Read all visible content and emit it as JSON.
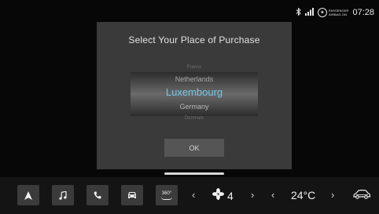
{
  "statusbar": {
    "airbag_line1": "PASSENGER",
    "airbag_line2": "AIRBAG ON",
    "time": "07:28"
  },
  "dialog": {
    "title": "Select Your Place of Purchase",
    "picker": {
      "items": [
        "France",
        "Netherlands",
        "Luxembourg",
        "Germany",
        "Denmark"
      ],
      "selected": "Luxembourg"
    },
    "ok_label": "OK"
  },
  "dock": {
    "camera_label": "360°",
    "fan_level": "4",
    "temperature": "24°C"
  },
  "colors": {
    "selected_accent": "#74c6e8",
    "dialog_bg": "#3a3a3a",
    "dock_button_bg": "#3b3b3b"
  }
}
